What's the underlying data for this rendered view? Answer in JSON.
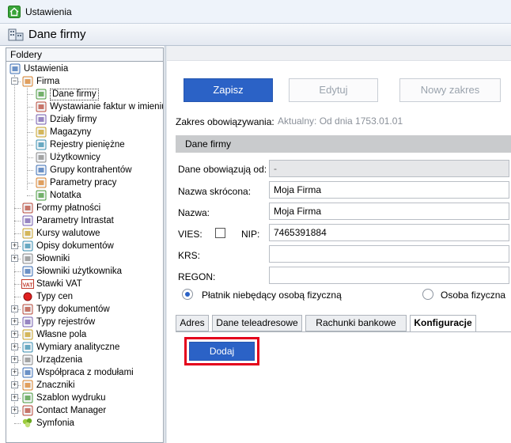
{
  "window": {
    "title": "Ustawienia"
  },
  "header": {
    "title": "Dane firmy"
  },
  "folders": {
    "heading": "Foldery",
    "items": [
      {
        "label": "Ustawienia",
        "icon": "tools-icon"
      },
      {
        "label": "Firma",
        "icon": "company-icon"
      },
      {
        "label": "Dane firmy",
        "icon": "company-data-icon",
        "selected": true
      },
      {
        "label": "Wystawianie faktur w imieniu",
        "icon": "person-icon"
      },
      {
        "label": "Działy firmy",
        "icon": "departments-icon"
      },
      {
        "label": "Magazyny",
        "icon": "warehouse-icon"
      },
      {
        "label": "Rejestry pieniężne",
        "icon": "money-register-icon"
      },
      {
        "label": "Użytkownicy",
        "icon": "users-icon"
      },
      {
        "label": "Grupy kontrahentów",
        "icon": "contractor-groups-icon"
      },
      {
        "label": "Parametry pracy",
        "icon": "work-params-icon"
      },
      {
        "label": "Notatka",
        "icon": "note-icon"
      },
      {
        "label": "Formy płatności",
        "icon": "payment-forms-icon"
      },
      {
        "label": "Parametry Intrastat",
        "icon": "intrastat-icon"
      },
      {
        "label": "Kursy walutowe",
        "icon": "exchange-rate-icon"
      },
      {
        "label": "Opisy dokumentów",
        "icon": "doc-descriptions-icon"
      },
      {
        "label": "Słowniki",
        "icon": "dictionaries-icon"
      },
      {
        "label": "Słowniki użytkownika",
        "icon": "user-dictionaries-icon"
      },
      {
        "label": "Stawki VAT",
        "icon": "vat-icon",
        "icon_text": "VAT"
      },
      {
        "label": "Typy cen",
        "icon": "price-types-icon"
      },
      {
        "label": "Typy dokumentów",
        "icon": "document-types-icon"
      },
      {
        "label": "Typy rejestrów",
        "icon": "register-types-icon"
      },
      {
        "label": "Własne pola",
        "icon": "custom-fields-icon"
      },
      {
        "label": "Wymiary analityczne",
        "icon": "analytic-dimensions-icon"
      },
      {
        "label": "Urządzenia",
        "icon": "devices-icon"
      },
      {
        "label": "Współpraca z modułami",
        "icon": "modules-icon"
      },
      {
        "label": "Znaczniki",
        "icon": "markers-icon"
      },
      {
        "label": "Szablon wydruku",
        "icon": "print-template-icon"
      },
      {
        "label": "Contact Manager",
        "icon": "contact-manager-icon"
      },
      {
        "label": "Symfonia",
        "icon": "symfonia-icon"
      }
    ]
  },
  "toolbar": {
    "save": "Zapisz",
    "edit": "Edytuj",
    "new_range": "Nowy zakres"
  },
  "form": {
    "scope_label": "Zakres obowiązywania:",
    "scope_value": "Aktualny: Od dnia 1753.01.01",
    "section_title": "Dane firmy",
    "valid_from_label": "Dane obowiązują od:",
    "valid_from_value": "-",
    "short_name_label": "Nazwa skrócona:",
    "short_name_value": "Moja Firma",
    "name_label": "Nazwa:",
    "name_value": "Moja Firma",
    "vies_label": "VIES:",
    "vies_checked": false,
    "nip_label": "NIP:",
    "nip_value": "7465391884",
    "krs_label": "KRS:",
    "krs_value": "",
    "regon_label": "REGON:",
    "regon_value": "",
    "radio_non_person": "Płatnik niebędący osobą fizyczną",
    "radio_person": "Osoba fizyczna",
    "selected_payer": "Płatnik niebędący osobą fizyczną"
  },
  "tabs": [
    "Adres",
    "Dane teleadresowe",
    "Rachunki bankowe",
    "Konfiguracje"
  ],
  "active_tab": "Konfiguracje",
  "config": {
    "add": "Dodaj"
  },
  "colors": {
    "primary": "#2b62c6",
    "highlight": "#e4001b",
    "section": "#c9cbcd"
  }
}
